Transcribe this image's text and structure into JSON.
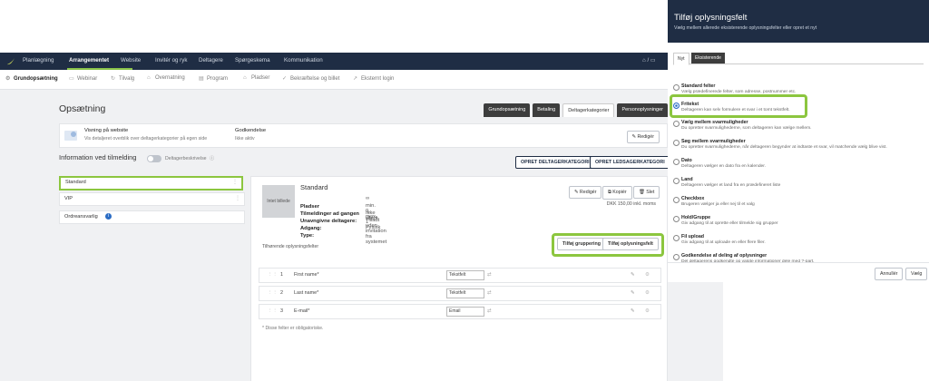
{
  "nav": {
    "items": [
      "Planlægning",
      "Arrangementet",
      "Website",
      "Invitér og ryk",
      "Deltagere",
      "Spørgeskema",
      "Kommunikation"
    ],
    "right": "⌂ / ▭"
  },
  "subnav": {
    "items": [
      {
        "icon": "⚙",
        "label": "Grundopsætning"
      },
      {
        "icon": "▭",
        "label": "Webinar"
      },
      {
        "icon": "↻",
        "label": "Tilvalg"
      },
      {
        "icon": "⌂",
        "label": "Overnatning"
      },
      {
        "icon": "▤",
        "label": "Program"
      },
      {
        "icon": "⌂",
        "label": "Pladser"
      },
      {
        "icon": "✓",
        "label": "Bekræftelse og billet"
      },
      {
        "icon": "↗",
        "label": "Eksternt login"
      }
    ]
  },
  "page": {
    "title": "Opsætning",
    "tabs": [
      "Grundopsætning",
      "Betaling",
      "Deltagerkategorier",
      "Personoplysninger"
    ],
    "selected_tab": "Deltagerkategorier"
  },
  "visning": {
    "title": "Visning på website",
    "desc": "Vis detaljeret overblik over deltagerkategorier på egen side",
    "godkendelse_label": "Godkendelse",
    "godkendelse_value": "Ikke aktiv",
    "edit": "Redigér"
  },
  "info": {
    "title": "Information ved tilmelding",
    "toggle_label": "Deltagerbeskrivelse",
    "btn_kategori": "OPRET DELTAGERKATEGORI",
    "btn_ledsager": "OPRET LEDSAGERKATEGORI"
  },
  "categories": [
    "Standard",
    "VIP"
  ],
  "ordreansvarlig": "Ordreansvarlig",
  "detail": {
    "image_placeholder": "Intet billede",
    "name": "Standard",
    "fields": [
      {
        "label": "Pladser",
        "value": "∞"
      },
      {
        "label": "Tilmeldinger ad gangen",
        "value": "min. 0, max. 1"
      },
      {
        "label": "Unavngivne deltagere:",
        "value": "Ikke tilladt"
      },
      {
        "label": "Adgang:",
        "value": "Tilladt uden invitation fra systemet"
      },
      {
        "label": "Type:",
        "value": "Fysisk"
      }
    ],
    "price": "DKK 150,00 inkl. moms",
    "btn_edit": "Redigér",
    "btn_copy": "Kopiér",
    "btn_delete": "Slet"
  },
  "felter": {
    "title": "Tilhørende oplysningsfelter",
    "btn_gruppering": "Tilføj gruppering",
    "btn_felt": "Tilføj oplysningsfelt",
    "rows": [
      {
        "num": "1",
        "name": "First name*",
        "type": "Tekstfelt"
      },
      {
        "num": "2",
        "name": "Last name*",
        "type": "Tekstfelt"
      },
      {
        "num": "3",
        "name": "E-mail*",
        "type": "Email"
      }
    ],
    "footnote": "* Disse felter er obligatoriske."
  },
  "panel": {
    "title": "Tilføj oplysningsfelt",
    "subtitle": "Vælg mellem allerede eksisterende oplysningsfelter eller opret et nyt",
    "tabs": [
      "Nyt",
      "Eksisterende"
    ],
    "options": [
      {
        "title": "Standard felter",
        "desc": "Vælg prædefinerede felter, som adresse, postnummer etc.",
        "selected": false
      },
      {
        "title": "Fritekst",
        "desc": "Deltageren kan selv formulere et svar i et tomt tekstfelt.",
        "selected": true
      },
      {
        "title": "Vælg mellem svarmuligheder",
        "desc": "Du opretter svarmulighederne, som deltageren kan vælge mellem.",
        "selected": false
      },
      {
        "title": "Søg mellem svarmuligheder",
        "desc": "Du opretter svarmulighederne, når deltageren begynder at indtaste et svar, vil matchende vælg blive vist.",
        "selected": false
      },
      {
        "title": "Dato",
        "desc": "Deltageren vælger en dato fra en kalender.",
        "selected": false
      },
      {
        "title": "Land",
        "desc": "Deltageren vælger et land fra en prædefineret liste",
        "selected": false
      },
      {
        "title": "Checkbox",
        "desc": "Brugeren vælger ja eller nej til et valg",
        "selected": false
      },
      {
        "title": "Hold/Gruppe",
        "desc": "Giv adgang til at oprette eller tilmelde sig grupper",
        "selected": false
      },
      {
        "title": "Fil upload",
        "desc": "Giv adgang til at uploade en eller flere filer.",
        "selected": false
      },
      {
        "title": "Godkendelse af deling af oplysninger",
        "desc": "Del deltagerens godkendte og valgte informationer dele med ?-part.",
        "selected": false
      }
    ],
    "cancel": "Annullér",
    "choose": "Vælg"
  },
  "colors": {
    "navy": "#1f2d44",
    "accent": "#8cc63f",
    "blue": "#2b6cc4"
  }
}
